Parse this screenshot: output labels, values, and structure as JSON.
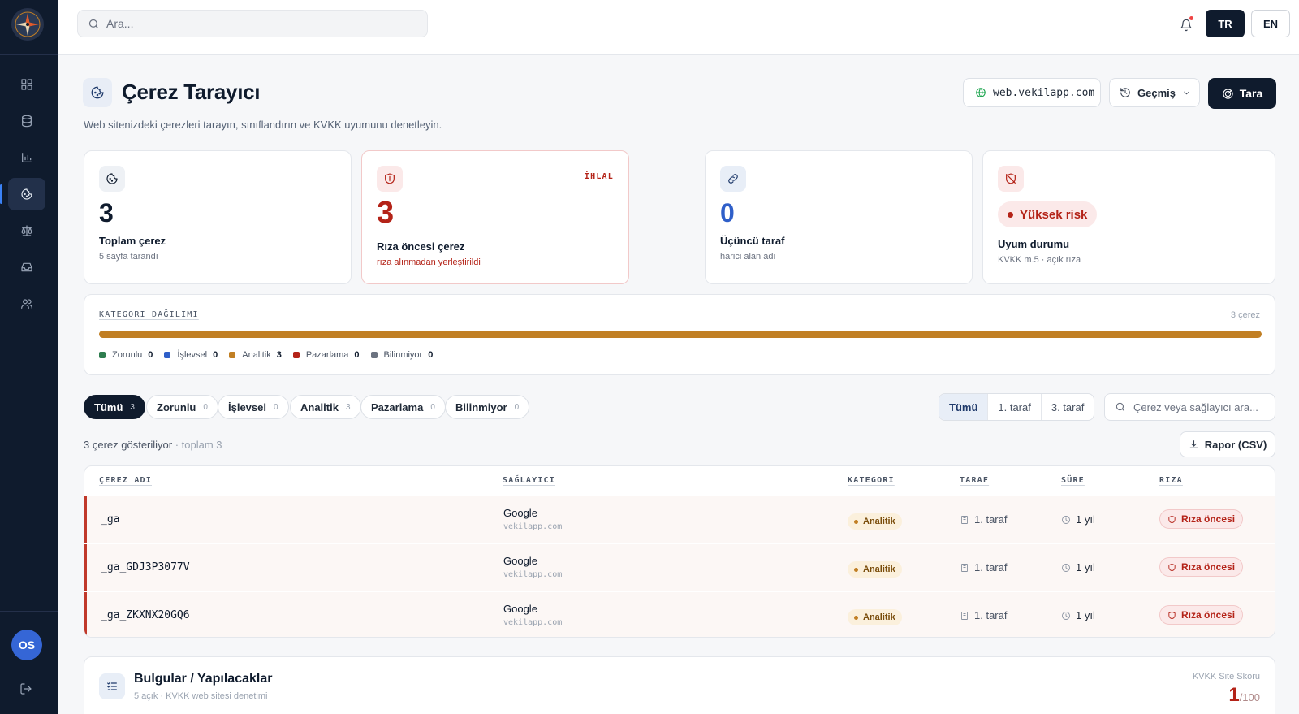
{
  "sidebar": {
    "nav_icons": [
      "dashboard-icon",
      "database-icon",
      "bar-chart-icon",
      "cookie-icon",
      "scale-icon",
      "inbox-icon",
      "users-icon"
    ],
    "active_index": 3,
    "avatar_initials": "OS"
  },
  "topbar": {
    "search_placeholder": "Ara...",
    "lang_tr": "TR",
    "lang_en": "EN"
  },
  "header": {
    "title": "Çerez Tarayıcı",
    "subtitle": "Web sitenizdeki çerezleri tarayın, sınıflandırın ve KVKK uyumunu denetleyin.",
    "domain": "web.vekilapp.com",
    "history_label": "Geçmiş",
    "scan_label": "Tara"
  },
  "stats": {
    "total": {
      "value": "3",
      "label": "Toplam çerez",
      "sub": "5 sayfa tarandı"
    },
    "preconsent": {
      "value": "3",
      "label": "Rıza öncesi çerez",
      "sub": "rıza alınmadan yerleştirildi",
      "tag": "İHLAL"
    },
    "third_party": {
      "value": "0",
      "label": "Üçüncü taraf",
      "sub": "harici alan adı"
    },
    "compliance": {
      "badge": "Yüksek risk",
      "label": "Uyum durumu",
      "sub": "KVKK m.5 · açık rıza"
    }
  },
  "distribution": {
    "heading": "KATEGORI DAĞILIMI",
    "total_text": "3 çerez",
    "categories": [
      {
        "name": "Zorunlu",
        "count": 0,
        "color": "#2e7d4f"
      },
      {
        "name": "İşlevsel",
        "count": 0,
        "color": "#2f5fc9"
      },
      {
        "name": "Analitik",
        "count": 3,
        "color": "#c17f24"
      },
      {
        "name": "Pazarlama",
        "count": 0,
        "color": "#b42318"
      },
      {
        "name": "Bilinmiyor",
        "count": 0,
        "color": "#6b7280"
      }
    ]
  },
  "filters": {
    "chips": [
      {
        "label": "Tümü",
        "count": "3"
      },
      {
        "label": "Zorunlu",
        "count": "0"
      },
      {
        "label": "İşlevsel",
        "count": "0"
      },
      {
        "label": "Analitik",
        "count": "3"
      },
      {
        "label": "Pazarlama",
        "count": "0"
      },
      {
        "label": "Bilinmiyor",
        "count": "0"
      }
    ],
    "party_segments": [
      "Tümü",
      "1. taraf",
      "3. taraf"
    ],
    "search_placeholder": "Çerez veya sağlayıcı ara..."
  },
  "results": {
    "showing": "3 çerez gösteriliyor",
    "total": "· toplam 3",
    "csv_label": "Rapor (CSV)"
  },
  "table": {
    "headers": [
      "ÇEREZ ADI",
      "SAĞLAYICI",
      "KATEGORI",
      "TARAF",
      "SÜRE",
      "RIZA"
    ],
    "rows": [
      {
        "name": "_ga",
        "provider": "Google",
        "domain": "vekilapp.com",
        "category": "Analitik",
        "party": "1. taraf",
        "duration": "1 yıl",
        "consent": "Rıza öncesi"
      },
      {
        "name": "_ga_GDJ3P3077V",
        "provider": "Google",
        "domain": "vekilapp.com",
        "category": "Analitik",
        "party": "1. taraf",
        "duration": "1 yıl",
        "consent": "Rıza öncesi"
      },
      {
        "name": "_ga_ZKXNX20GQ6",
        "provider": "Google",
        "domain": "vekilapp.com",
        "category": "Analitik",
        "party": "1. taraf",
        "duration": "1 yıl",
        "consent": "Rıza öncesi"
      }
    ]
  },
  "findings": {
    "title": "Bulgular / Yapılacaklar",
    "sub": "5 açık · KVKK web sitesi denetimi",
    "score_label": "KVKK Site Skoru",
    "score": "1",
    "score_max": "/100"
  }
}
